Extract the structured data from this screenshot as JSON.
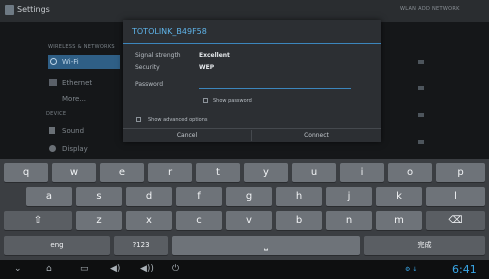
{
  "topbar": {
    "title": "Settings",
    "right_text": "WLAN  ADD NETWORK"
  },
  "settings": {
    "section_wireless": "WIRELESS & NETWORKS",
    "section_device": "DEVICE",
    "items": [
      {
        "label": "Wi-Fi"
      },
      {
        "label": "Ethernet"
      },
      {
        "label": "More..."
      },
      {
        "label": "Sound"
      },
      {
        "label": "Display"
      }
    ]
  },
  "dialog": {
    "title": "TOTOLINK_B49F58",
    "signal_label": "Signal strength",
    "signal_value": "Excellent",
    "security_label": "Security",
    "security_value": "WEP",
    "password_label": "Password",
    "password_value": "",
    "show_password_label": "Show password",
    "show_password_checked": false,
    "advanced_label": "Show advanced options",
    "advanced_checked": false,
    "cancel_label": "Cancel",
    "connect_label": "Connect",
    "accent_color": "#3c86bd"
  },
  "keyboard": {
    "row1": [
      "q",
      "w",
      "e",
      "r",
      "t",
      "y",
      "u",
      "i",
      "o",
      "p"
    ],
    "row2": [
      "a",
      "s",
      "d",
      "f",
      "g",
      "h",
      "j",
      "k",
      "l"
    ],
    "row3": [
      "z",
      "x",
      "c",
      "v",
      "b",
      "n",
      "m"
    ],
    "shift_icon": "shift-icon",
    "delete_icon": "backspace-icon",
    "lang_label": "eng",
    "num_label": "?123",
    "done_label": "完成"
  },
  "navbar": {
    "clock": "6:41",
    "status_text": "⚙ ↓"
  }
}
